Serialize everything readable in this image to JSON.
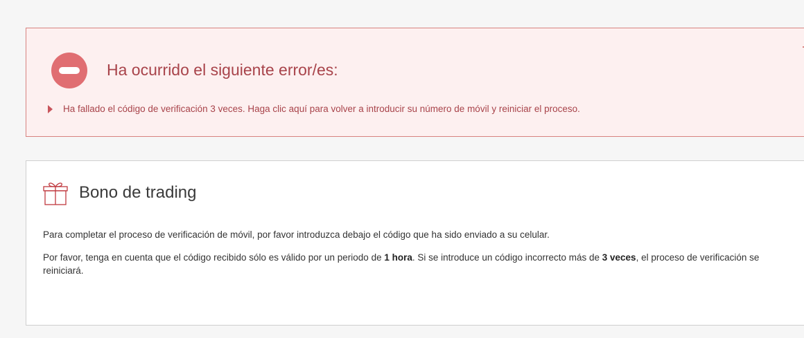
{
  "error": {
    "title": "Ha ocurrido el siguiente error/es:",
    "items": [
      "Ha fallado el código de verificación 3 veces. Haga clic aquí para volver a introducir su número de móvil y reiniciar el proceso."
    ],
    "icon": "minus-circle-icon",
    "collapse_icon": "minus-icon",
    "colors": {
      "background": "#fdf0f0",
      "border": "#d7827f",
      "accent": "#e06e72",
      "text": "#a8434a"
    }
  },
  "card": {
    "icon": "gift-icon",
    "title": "Bono de trading",
    "p1": "Para completar el proceso de verificación de móvil, por favor introduzca debajo el código que ha sido enviado a su celular.",
    "p2": {
      "part1": "Por favor, tenga en cuenta que el código recibido sólo es válido por un periodo de ",
      "bold1": "1 hora",
      "part2": ". Si se introduce un código incorrecto más de ",
      "bold2": "3 veces",
      "part3": ", el proceso de verificación se reiniciará."
    }
  }
}
